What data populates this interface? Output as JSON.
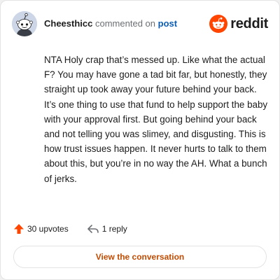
{
  "header": {
    "username": "Cheesthicc",
    "action_text": "commented on",
    "post_link_label": "post",
    "brand_wordmark": "reddit",
    "avatar_icon": "snoo-avatar-icon",
    "brand_icon": "reddit-alien-icon"
  },
  "comment": {
    "text": "NTA Holy crap that’s messed up. Like what the actual F? You may have gone a tad bit far, but honestly, they straight up took away your future behind your back. It’s one thing to use that fund to help support the baby with your approval first. But going behind your back and not telling you was slimey, and disgusting. This is how trust issues happen. It never hurts to talk to them about this, but you’re in no way the AH. What a bunch of jerks."
  },
  "footer": {
    "upvotes_label": "30 upvotes",
    "replies_label": "1 reply",
    "view_button_label": "View the conversation",
    "upvote_icon": "upvote-arrow-icon",
    "reply_icon": "reply-arrow-icon"
  },
  "colors": {
    "brand_orange": "#ff4500",
    "link_blue": "#0a5db5",
    "button_text": "#c24a00",
    "text": "#1c1c1c",
    "muted": "#6b6f73",
    "avatar_bg": "#ccd6e6"
  }
}
